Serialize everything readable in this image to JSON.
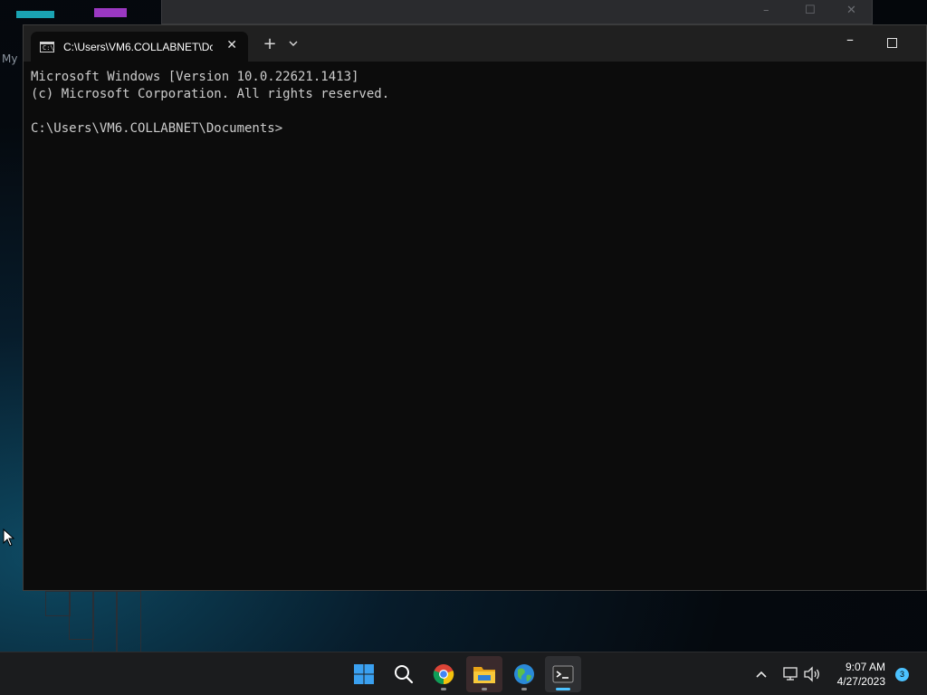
{
  "desktop": {
    "label_fragment": "My"
  },
  "terminal": {
    "tab_title": "C:\\Users\\VM6.COLLABNET\\Dc",
    "tab_icon_text": "C:\\",
    "console_lines": [
      "Microsoft Windows [Version 10.0.22621.1413]",
      "(c) Microsoft Corporation. All rights reserved.",
      "",
      "C:\\Users\\VM6.COLLABNET\\Documents>"
    ]
  },
  "taskbar": {
    "apps": [
      {
        "name": "start-button",
        "icon": "windows-logo-icon"
      },
      {
        "name": "search-button",
        "icon": "search-icon"
      },
      {
        "name": "chrome-button",
        "icon": "chrome-icon"
      },
      {
        "name": "file-explorer-button",
        "icon": "folder-icon"
      },
      {
        "name": "browser-app-button",
        "icon": "globe-icon"
      },
      {
        "name": "terminal-button",
        "icon": "terminal-icon"
      }
    ],
    "clock": {
      "time": "9:07 AM",
      "date": "4/27/2023"
    },
    "notification_count": "3"
  },
  "colors": {
    "terminal_bg": "#0c0c0c",
    "titlebar_bg": "#202020",
    "taskbar_bg": "#1b1c1e",
    "accent": "#4cc2ff"
  }
}
